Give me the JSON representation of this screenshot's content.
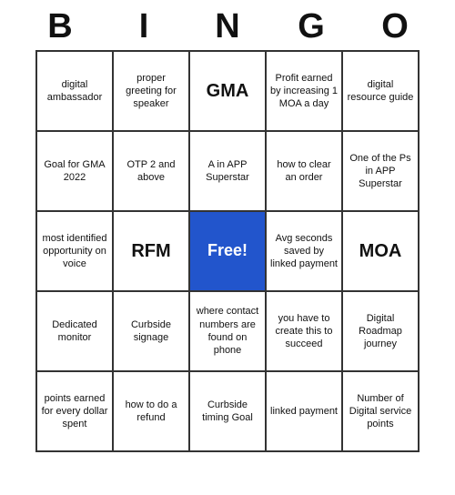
{
  "header": {
    "letters": [
      "B",
      "I",
      "N",
      "G",
      "O"
    ]
  },
  "cells": [
    {
      "text": "digital ambassador",
      "style": "normal"
    },
    {
      "text": "proper greeting for speaker",
      "style": "normal"
    },
    {
      "text": "GMA",
      "style": "large"
    },
    {
      "text": "Profit earned by increasing 1 MOA a day",
      "style": "normal"
    },
    {
      "text": "digital resource guide",
      "style": "normal"
    },
    {
      "text": "Goal for GMA 2022",
      "style": "normal"
    },
    {
      "text": "OTP 2 and above",
      "style": "normal"
    },
    {
      "text": "A in APP Superstar",
      "style": "normal"
    },
    {
      "text": "how to clear an order",
      "style": "normal"
    },
    {
      "text": "One of the Ps in APP Superstar",
      "style": "normal"
    },
    {
      "text": "most identified opportunity on voice",
      "style": "normal"
    },
    {
      "text": "RFM",
      "style": "large"
    },
    {
      "text": "Free!",
      "style": "free"
    },
    {
      "text": "Avg seconds saved by linked payment",
      "style": "normal"
    },
    {
      "text": "MOA",
      "style": "large"
    },
    {
      "text": "Dedicated monitor",
      "style": "normal"
    },
    {
      "text": "Curbside signage",
      "style": "normal"
    },
    {
      "text": "where contact numbers are found on phone",
      "style": "normal"
    },
    {
      "text": "you have to create this to succeed",
      "style": "normal"
    },
    {
      "text": "Digital Roadmap journey",
      "style": "normal"
    },
    {
      "text": "points earned for every dollar spent",
      "style": "normal"
    },
    {
      "text": "how to do a refund",
      "style": "normal"
    },
    {
      "text": "Curbside timing Goal",
      "style": "normal"
    },
    {
      "text": "linked payment",
      "style": "normal"
    },
    {
      "text": "Number of Digital service points",
      "style": "normal"
    }
  ]
}
